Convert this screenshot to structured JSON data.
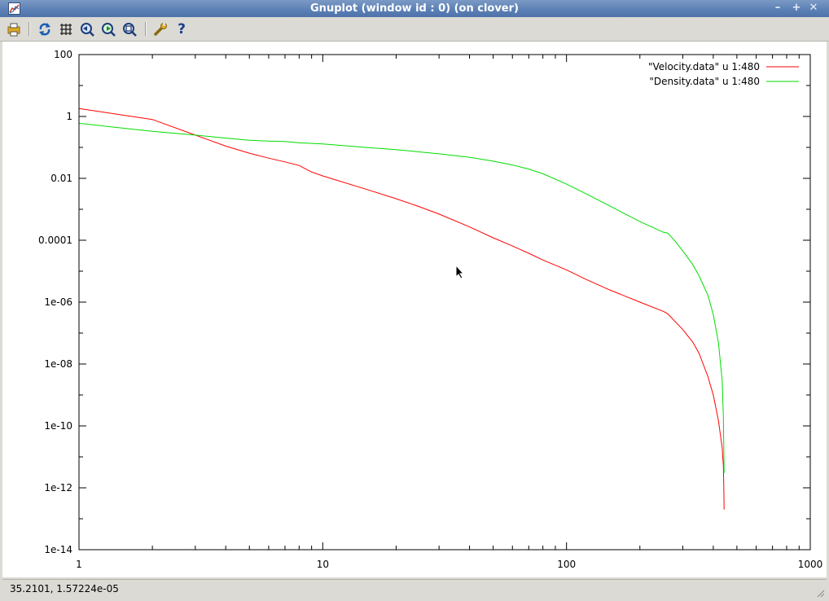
{
  "window": {
    "title": "Gnuplot (window id : 0) (on clover)"
  },
  "window_buttons": [
    {
      "name": "minimize",
      "glyph": "–"
    },
    {
      "name": "maximize",
      "glyph": "+"
    },
    {
      "name": "close",
      "glyph": "✕"
    }
  ],
  "toolbar": [
    {
      "name": "print-icon"
    },
    {
      "name": "replot-icon"
    },
    {
      "name": "grid-icon"
    },
    {
      "name": "zoom-back-icon"
    },
    {
      "name": "zoom-forward-icon"
    },
    {
      "name": "unzoom-icon"
    },
    {
      "name": "options-icon"
    },
    {
      "name": "help-icon"
    }
  ],
  "status": {
    "coordinates": "35.2101,  1.57224e-05"
  },
  "chart_data": {
    "type": "line",
    "x_scale": "log",
    "y_scale": "log",
    "xlim": [
      1,
      1000
    ],
    "ylim": [
      1e-14,
      100
    ],
    "xticks": [
      {
        "value": 1,
        "label": "1"
      },
      {
        "value": 10,
        "label": "10"
      },
      {
        "value": 100,
        "label": "100"
      },
      {
        "value": 1000,
        "label": "1000"
      }
    ],
    "yticks": [
      {
        "value": 100,
        "label": "100"
      },
      {
        "value": 1,
        "label": "1"
      },
      {
        "value": 0.01,
        "label": "0.01"
      },
      {
        "value": 0.0001,
        "label": "0.0001"
      },
      {
        "value": 1e-06,
        "label": "1e-06"
      },
      {
        "value": 1e-08,
        "label": "1e-08"
      },
      {
        "value": 1e-10,
        "label": "1e-10"
      },
      {
        "value": 1e-12,
        "label": "1e-12"
      },
      {
        "value": 1e-14,
        "label": "1e-14"
      }
    ],
    "grid": false,
    "legend_position": "top-right",
    "series": [
      {
        "name": "\"Velocity.data\" u 1:480",
        "color": "#ff0000",
        "points": [
          [
            1,
            1.8
          ],
          [
            2,
            0.8
          ],
          [
            3,
            0.25
          ],
          [
            4,
            0.11
          ],
          [
            5,
            0.065
          ],
          [
            6,
            0.045
          ],
          [
            7,
            0.034
          ],
          [
            8,
            0.026
          ],
          [
            9,
            0.016
          ],
          [
            10,
            0.012
          ],
          [
            15,
            0.0045
          ],
          [
            20,
            0.0022
          ],
          [
            25,
            0.0012
          ],
          [
            30,
            0.0007
          ],
          [
            40,
            0.00027
          ],
          [
            50,
            0.00012
          ],
          [
            60,
            6.5e-05
          ],
          [
            70,
            3.8e-05
          ],
          [
            80,
            2.3e-05
          ],
          [
            100,
            1.1e-05
          ],
          [
            120,
            5.5e-06
          ],
          [
            150,
            2.5e-06
          ],
          [
            200,
            1e-06
          ],
          [
            250,
            5e-07
          ],
          [
            260,
            4.2e-07
          ],
          [
            300,
            1.3e-07
          ],
          [
            330,
            5e-08
          ],
          [
            350,
            2.2e-08
          ],
          [
            380,
            4e-09
          ],
          [
            400,
            1e-09
          ],
          [
            420,
            1.5e-10
          ],
          [
            435,
            2e-11
          ],
          [
            440,
            5e-12
          ],
          [
            442,
            8e-13
          ],
          [
            443,
            2e-13
          ]
        ]
      },
      {
        "name": "\"Density.data\" u 1:480",
        "color": "#00dd00",
        "points": [
          [
            1,
            0.6
          ],
          [
            2,
            0.33
          ],
          [
            3,
            0.25
          ],
          [
            4,
            0.2
          ],
          [
            5,
            0.17
          ],
          [
            6,
            0.16
          ],
          [
            7,
            0.155
          ],
          [
            8,
            0.14
          ],
          [
            10,
            0.13
          ],
          [
            15,
            0.1
          ],
          [
            20,
            0.085
          ],
          [
            30,
            0.062
          ],
          [
            40,
            0.048
          ],
          [
            50,
            0.036
          ],
          [
            60,
            0.027
          ],
          [
            70,
            0.02
          ],
          [
            80,
            0.014
          ],
          [
            100,
            0.0065
          ],
          [
            120,
            0.0032
          ],
          [
            150,
            0.0013
          ],
          [
            200,
            0.0004
          ],
          [
            250,
            0.00018
          ],
          [
            260,
            0.00017
          ],
          [
            280,
            9e-05
          ],
          [
            300,
            4.5e-05
          ],
          [
            330,
            1.6e-05
          ],
          [
            350,
            7e-06
          ],
          [
            380,
            1.7e-06
          ],
          [
            400,
            4e-07
          ],
          [
            420,
            5e-08
          ],
          [
            435,
            3e-09
          ],
          [
            440,
            2e-10
          ],
          [
            443,
            3e-12
          ]
        ]
      }
    ]
  }
}
